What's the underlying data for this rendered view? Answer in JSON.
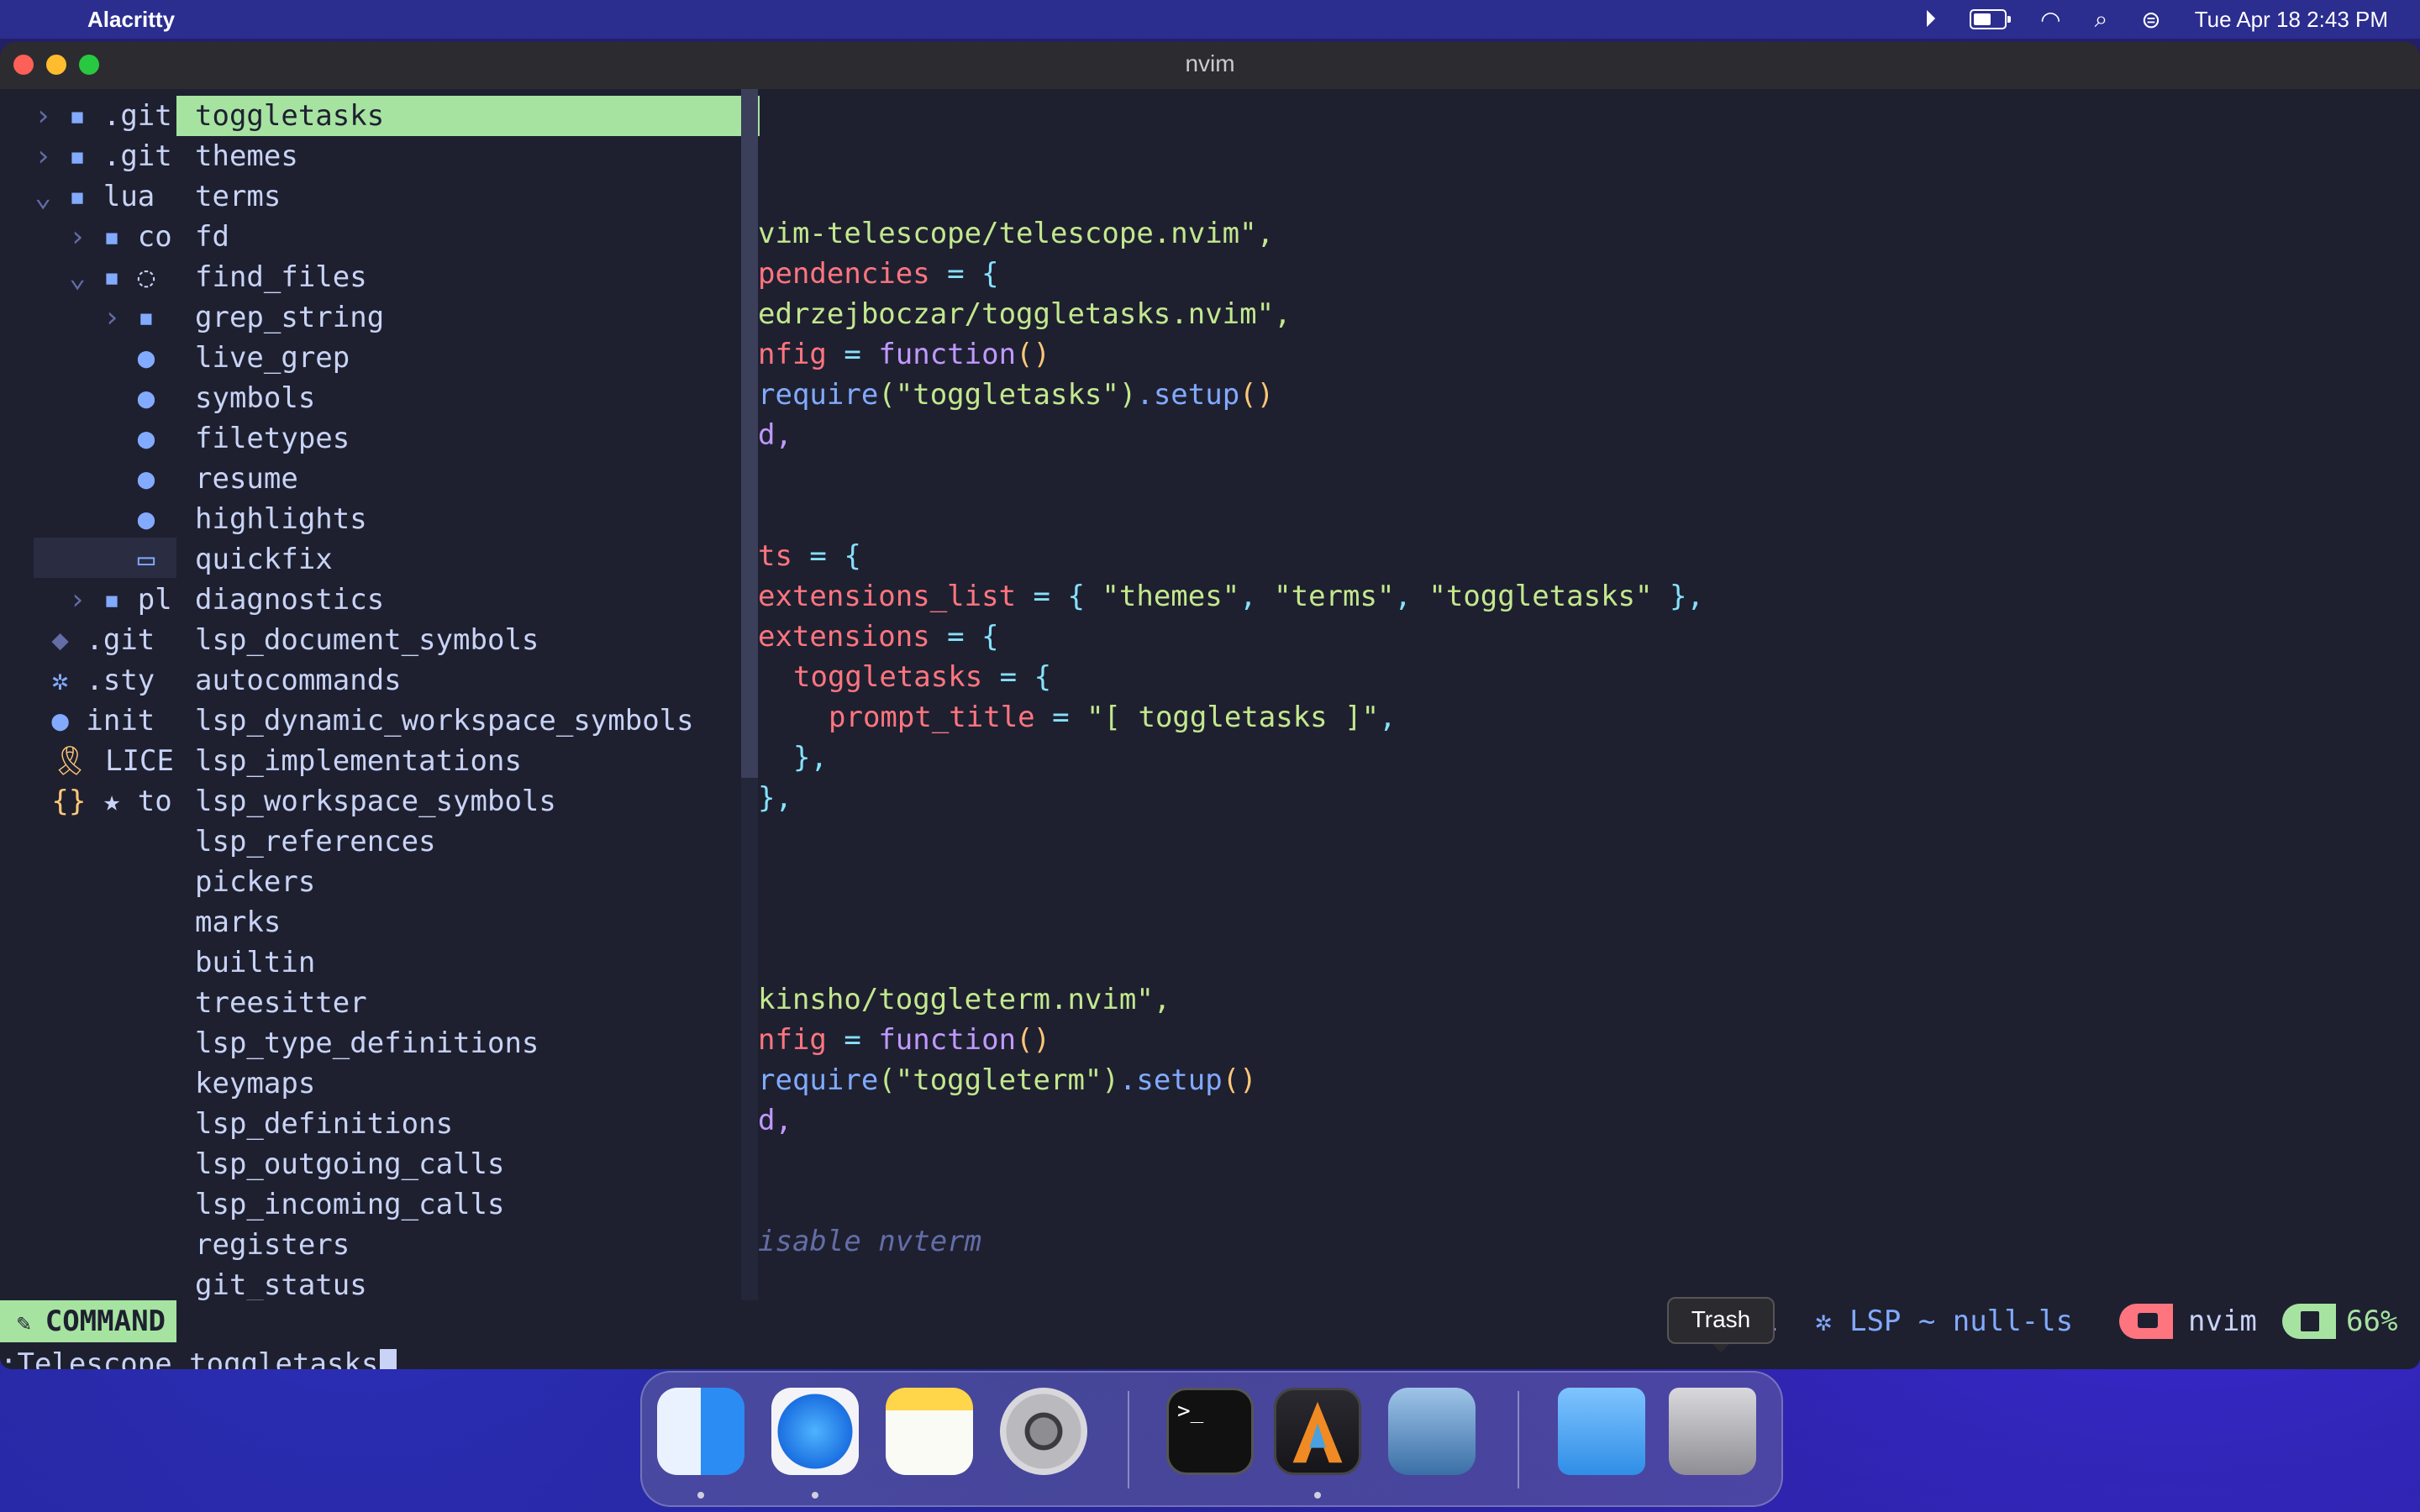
{
  "menubar": {
    "app_name": "Alacritty",
    "datetime": "Tue Apr 18  2:43 PM"
  },
  "window": {
    "title": "nvim"
  },
  "tree": [
    {
      "indent": "  › ",
      "icon": "▪",
      "name": ".git"
    },
    {
      "indent": "  › ",
      "icon": "▪",
      "name": ".git"
    },
    {
      "indent": "  ⌄ ",
      "icon": "▪",
      "name": "lua"
    },
    {
      "indent": "    › ",
      "icon": "▪",
      "name": "co"
    },
    {
      "indent": "    ⌄ ",
      "icon": "▪",
      "name": "◌"
    },
    {
      "indent": "      › ",
      "icon": "▪",
      "name": ""
    },
    {
      "indent": "        ",
      "icon": "●",
      "name": ""
    },
    {
      "indent": "        ",
      "icon": "●",
      "name": ""
    },
    {
      "indent": "        ",
      "icon": "●",
      "name": ""
    },
    {
      "indent": "        ",
      "icon": "●",
      "name": ""
    },
    {
      "indent": "        ",
      "icon": "●",
      "name": ""
    },
    {
      "indent": "        ",
      "icon": "▭",
      "name": ""
    },
    {
      "indent": "    › ",
      "icon": "▪",
      "name": "pl"
    },
    {
      "indent": "   ",
      "icon": "◆",
      "name": ".git"
    },
    {
      "indent": "   ",
      "icon": "✲",
      "name": ".sty"
    },
    {
      "indent": "   ",
      "icon": "●",
      "name": "init"
    },
    {
      "indent": "   ",
      "icon": "🎗",
      "name": "LICE"
    },
    {
      "indent": "   ",
      "icon": "{}",
      "name": "★ to"
    }
  ],
  "completion": {
    "selected": "toggletasks",
    "items": [
      "toggletasks",
      "themes",
      "terms",
      "fd",
      "find_files",
      "grep_string",
      "live_grep",
      "symbols",
      "filetypes",
      "resume",
      "highlights",
      "quickfix",
      "diagnostics",
      "lsp_document_symbols",
      "autocommands",
      "lsp_dynamic_workspace_symbols",
      "lsp_implementations",
      "lsp_workspace_symbols",
      "lsp_references",
      "pickers",
      "marks",
      "builtin",
      "treesitter",
      "lsp_type_definitions",
      "keymaps",
      "lsp_definitions",
      "lsp_outgoing_calls",
      "lsp_incoming_calls",
      "registers",
      "git_status"
    ]
  },
  "code": {
    "l1": "vim-telescope/telescope.nvim\",",
    "l2a": "pendencies",
    "l2b": " = {",
    "l3": "edrzejboczar/toggletasks.nvim\",",
    "l4a": "nfig",
    "l4b": " = ",
    "l4c": "function",
    "l4d": "()",
    "l5a": "require",
    "l5b": "(\"toggletasks\")",
    "l5c": ".setup",
    "l5d": "()",
    "l6": "d,",
    "l7a": "ts",
    "l7b": " = {",
    "l8a": "extensions_list",
    "l8b": " = { ",
    "l8c": "\"themes\"",
    "l8d": ", ",
    "l8e": "\"terms\"",
    "l8f": ", ",
    "l8g": "\"toggletasks\"",
    "l8h": " },",
    "l9a": "extensions",
    "l9b": " = {",
    "l10a": "toggletasks",
    "l10b": " = {",
    "l11a": "prompt_title",
    "l11b": " = ",
    "l11c": "\"[ toggletasks ]\"",
    "l11d": ",",
    "l12": "},",
    "l13": "},",
    "l14": "kinsho/toggleterm.nvim\",",
    "l15a": "nfig",
    "l15b": " = ",
    "l15c": "function",
    "l15d": "()",
    "l16a": "require",
    "l16b": "(\"toggleterm\")",
    "l16c": ".setup",
    "l16d": "()",
    "l17": "d,",
    "l18": "isable nvterm"
  },
  "statusline": {
    "mode": "COMMAND",
    "diag_count": "1",
    "lsp": "LSP ~ null-ls",
    "cwd": "nvim",
    "percent": "66%"
  },
  "cmdline": {
    "prefix": ":Telescope ",
    "arg": "toggletasks"
  },
  "tooltip": "Trash",
  "colors": {
    "selection": "#a6e3a1",
    "background": "#1e2030",
    "accent_pink": "#ff757f"
  },
  "dock": {
    "apps": [
      "finder-icon",
      "safari-icon",
      "notes-icon",
      "system-settings-icon",
      "terminal-icon",
      "alacritty-icon",
      "preview-icon",
      "downloads-folder-icon",
      "trash-icon"
    ]
  }
}
